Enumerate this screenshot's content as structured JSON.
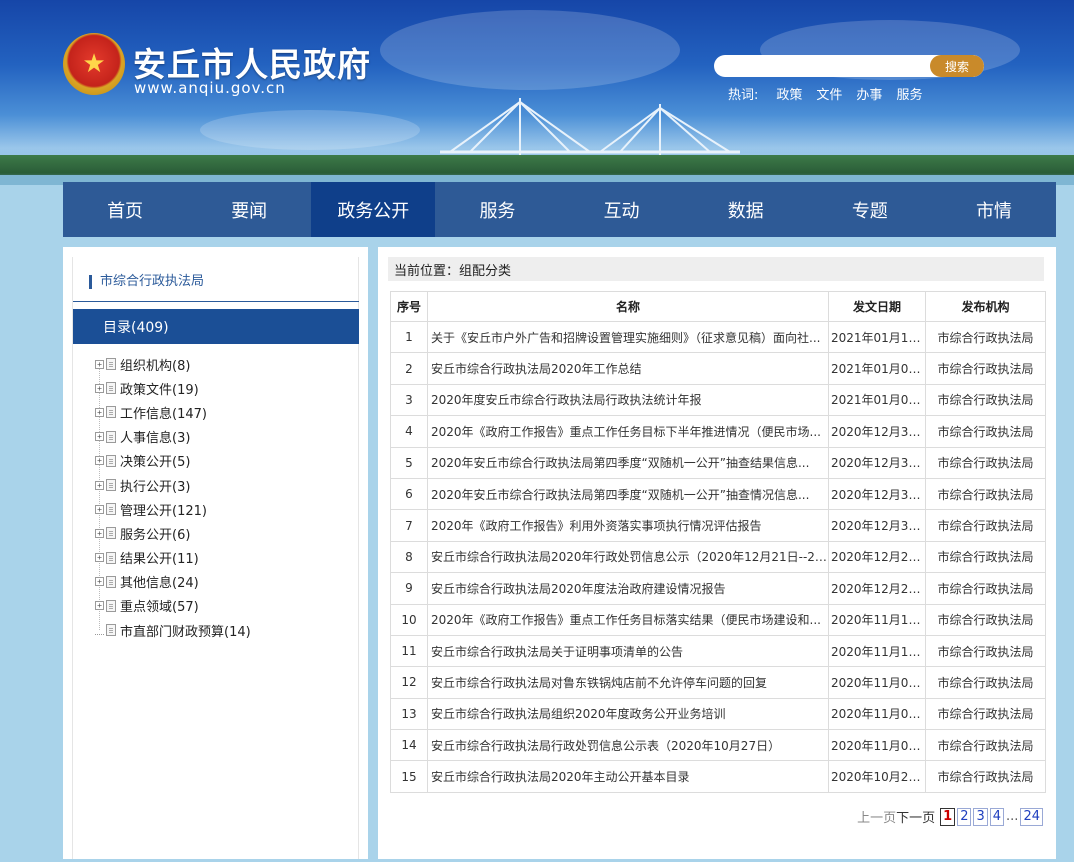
{
  "header": {
    "site_title": "安丘市人民政府",
    "site_url": "www.anqiu.gov.cn",
    "search_button": "搜索",
    "search_placeholder": "",
    "hotwords_label": "热词:",
    "hotwords": [
      "政策",
      "文件",
      "办事",
      "服务"
    ]
  },
  "nav": {
    "items": [
      "首页",
      "要闻",
      "政务公开",
      "服务",
      "互动",
      "数据",
      "专题",
      "市情"
    ],
    "active": "政务公开"
  },
  "sidebar": {
    "department": "市综合行政执法局",
    "catalog": "目录(409)",
    "items": [
      {
        "label": "组织机构(8)",
        "expandable": true
      },
      {
        "label": "政策文件(19)",
        "expandable": true
      },
      {
        "label": "工作信息(147)",
        "expandable": true
      },
      {
        "label": "人事信息(3)",
        "expandable": true
      },
      {
        "label": "决策公开(5)",
        "expandable": true
      },
      {
        "label": "执行公开(3)",
        "expandable": true
      },
      {
        "label": "管理公开(121)",
        "expandable": true
      },
      {
        "label": "服务公开(6)",
        "expandable": true
      },
      {
        "label": "结果公开(11)",
        "expandable": true
      },
      {
        "label": "其他信息(24)",
        "expandable": true
      },
      {
        "label": "重点领域(57)",
        "expandable": true
      },
      {
        "label": "市直部门财政预算(14)",
        "expandable": false
      }
    ]
  },
  "main": {
    "breadcrumb": "当前位置：组配分类",
    "columns": [
      "序号",
      "名称",
      "发文日期",
      "发布机构"
    ],
    "rows": [
      {
        "no": "1",
        "title": "关于《安丘市户外广告和招牌设置管理实施细则》（征求意见稿）面向社...",
        "date": "2021年01月14...",
        "org": "市综合行政执法局"
      },
      {
        "no": "2",
        "title": "安丘市综合行政执法局2020年工作总结",
        "date": "2021年01月02...",
        "org": "市综合行政执法局"
      },
      {
        "no": "3",
        "title": "2020年度安丘市综合行政执法局行政执法统计年报",
        "date": "2021年01月02...",
        "org": "市综合行政执法局"
      },
      {
        "no": "4",
        "title": "2020年《政府工作报告》重点工作任务目标下半年推进情况（便民市场...",
        "date": "2020年12月31...",
        "org": "市综合行政执法局"
      },
      {
        "no": "5",
        "title": "2020年安丘市综合行政执法局第四季度“双随机一公开”抽查结果信息...",
        "date": "2020年12月31...",
        "org": "市综合行政执法局"
      },
      {
        "no": "6",
        "title": "2020年安丘市综合行政执法局第四季度“双随机一公开”抽查情况信息...",
        "date": "2020年12月31...",
        "org": "市综合行政执法局"
      },
      {
        "no": "7",
        "title": "2020年《政府工作报告》利用外资落实事项执行情况评估报告",
        "date": "2020年12月30...",
        "org": "市综合行政执法局"
      },
      {
        "no": "8",
        "title": "安丘市综合行政执法局2020年行政处罚信息公示（2020年12月21日--22...",
        "date": "2020年12月26...",
        "org": "市综合行政执法局"
      },
      {
        "no": "9",
        "title": "安丘市综合行政执法局2020年度法治政府建设情况报告",
        "date": "2020年12月25...",
        "org": "市综合行政执法局"
      },
      {
        "no": "10",
        "title": "2020年《政府工作报告》重点工作任务目标落实结果（便民市场建设和...",
        "date": "2020年11月14...",
        "org": "市综合行政执法局"
      },
      {
        "no": "11",
        "title": "安丘市综合行政执法局关于证明事项清单的公告",
        "date": "2020年11月10...",
        "org": "市综合行政执法局"
      },
      {
        "no": "12",
        "title": "安丘市综合行政执法局对鲁东铁锅炖店前不允许停车问题的回复",
        "date": "2020年11月09...",
        "org": "市综合行政执法局"
      },
      {
        "no": "13",
        "title": "安丘市综合行政执法局组织2020年度政务公开业务培训",
        "date": "2020年11月08...",
        "org": "市综合行政执法局"
      },
      {
        "no": "14",
        "title": "安丘市综合行政执法局行政处罚信息公示表（2020年10月27日）",
        "date": "2020年11月02...",
        "org": "市综合行政执法局"
      },
      {
        "no": "15",
        "title": "安丘市综合行政执法局2020年主动公开基本目录",
        "date": "2020年10月28...",
        "org": "市综合行政执法局"
      }
    ],
    "pager": {
      "prev": "上一页",
      "next": "下一页",
      "pages": [
        "1",
        "2",
        "3",
        "4"
      ],
      "current": "1",
      "ellipsis": "...",
      "last": "24"
    }
  },
  "icons": {
    "emblem": "national-emblem-icon",
    "tree_expand": "plus-square-icon",
    "tree_doc": "document-icon"
  },
  "colors": {
    "nav_bg": "#2e5a96",
    "nav_active": "#0f3f8a",
    "catalog_head": "#1b4f96",
    "search_button": "#c98a2a",
    "page_bg": "#a9d3ea"
  }
}
